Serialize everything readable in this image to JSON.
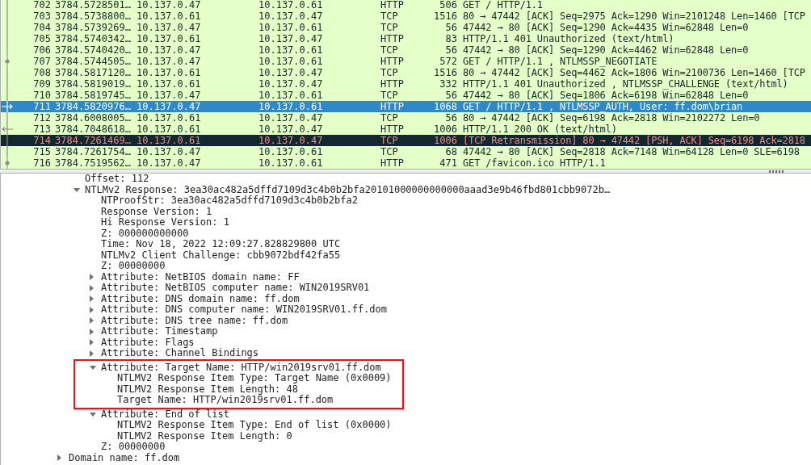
{
  "packet_list": {
    "rows": [
      {
        "no": "702",
        "time": "3784.5728501…",
        "source": "10.137.0.47",
        "destination": "10.137.0.61",
        "protocol": "HTTP",
        "length": "506",
        "info": "GET / HTTP/1.1",
        "kind": "normal",
        "endpoint": false,
        "request": false,
        "response": false,
        "selected": false
      },
      {
        "no": "703",
        "time": "3784.5738800…",
        "source": "10.137.0.61",
        "destination": "10.137.0.47",
        "protocol": "TCP",
        "length": "1516",
        "info": "80 → 47442 [ACK] Seq=2975 Ack=1290 Win=2101248 Len=1460 [TCP",
        "kind": "normal",
        "endpoint": false,
        "request": false,
        "response": false,
        "selected": false
      },
      {
        "no": "704",
        "time": "3784.5739269…",
        "source": "10.137.0.47",
        "destination": "10.137.0.61",
        "protocol": "TCP",
        "length": "56",
        "info": "47442 → 80 [ACK] Seq=1290 Ack=4435 Win=62848 Len=0",
        "kind": "normal",
        "endpoint": false,
        "request": false,
        "response": false,
        "selected": false
      },
      {
        "no": "705",
        "time": "3784.5740342…",
        "source": "10.137.0.61",
        "destination": "10.137.0.47",
        "protocol": "HTTP",
        "length": "83",
        "info": "HTTP/1.1 401 Unauthorized  (text/html)",
        "kind": "normal",
        "endpoint": false,
        "request": false,
        "response": false,
        "selected": false
      },
      {
        "no": "706",
        "time": "3784.5740420…",
        "source": "10.137.0.47",
        "destination": "10.137.0.61",
        "protocol": "TCP",
        "length": "56",
        "info": "47442 → 80 [ACK] Seq=1290 Ack=4462 Win=62848 Len=0",
        "kind": "normal",
        "endpoint": false,
        "request": false,
        "response": false,
        "selected": false
      },
      {
        "no": "707",
        "time": "3784.5744505…",
        "source": "10.137.0.47",
        "destination": "10.137.0.61",
        "protocol": "HTTP",
        "length": "572",
        "info": "GET / HTTP/1.1 , NTLMSSP_NEGOTIATE",
        "kind": "normal",
        "endpoint": true,
        "request": false,
        "response": false,
        "selected": false
      },
      {
        "no": "708",
        "time": "3784.5817120…",
        "source": "10.137.0.61",
        "destination": "10.137.0.47",
        "protocol": "TCP",
        "length": "1516",
        "info": "80 → 47442 [ACK] Seq=4462 Ack=1806 Win=2100736 Len=1460 [TCP",
        "kind": "normal",
        "endpoint": false,
        "request": false,
        "response": false,
        "selected": false
      },
      {
        "no": "709",
        "time": "3784.5819019…",
        "source": "10.137.0.61",
        "destination": "10.137.0.47",
        "protocol": "HTTP",
        "length": "332",
        "info": "HTTP/1.1 401 Unauthorized , NTLMSSP_CHALLENGE (text/html)",
        "kind": "normal",
        "endpoint": false,
        "request": false,
        "response": false,
        "selected": false
      },
      {
        "no": "710",
        "time": "3784.5819745…",
        "source": "10.137.0.47",
        "destination": "10.137.0.61",
        "protocol": "TCP",
        "length": "56",
        "info": "47442 → 80 [ACK] Seq=1806 Ack=6198 Win=62848 Len=0",
        "kind": "normal",
        "endpoint": false,
        "request": false,
        "response": false,
        "selected": false
      },
      {
        "no": "711",
        "time": "3784.5820976…",
        "source": "10.137.0.47",
        "destination": "10.137.0.61",
        "protocol": "HTTP",
        "length": "1068",
        "info": "GET / HTTP/1.1 , NTLMSSP_AUTH, User: ff.dom\\brian",
        "kind": "normal",
        "endpoint": false,
        "request": true,
        "response": false,
        "selected": true
      },
      {
        "no": "712",
        "time": "3784.6008005…",
        "source": "10.137.0.61",
        "destination": "10.137.0.47",
        "protocol": "TCP",
        "length": "56",
        "info": "80 → 47442 [ACK] Seq=6198 Ack=2818 Win=2102272 Len=0",
        "kind": "normal",
        "endpoint": false,
        "request": false,
        "response": false,
        "selected": false
      },
      {
        "no": "713",
        "time": "3784.7048618…",
        "source": "10.137.0.61",
        "destination": "10.137.0.47",
        "protocol": "HTTP",
        "length": "1006",
        "info": "HTTP/1.1 200 OK  (text/html)",
        "kind": "normal",
        "endpoint": false,
        "request": false,
        "response": true,
        "selected": false
      },
      {
        "no": "714",
        "time": "3784.7261469…",
        "source": "10.137.0.61",
        "destination": "10.137.0.47",
        "protocol": "TCP",
        "length": "1006",
        "info": "[TCP Retransmission] 80 → 47442 [PSH, ACK] Seq=6198 Ack=2818",
        "kind": "bad",
        "endpoint": false,
        "request": false,
        "response": false,
        "selected": false
      },
      {
        "no": "715",
        "time": "3784.7261754…",
        "source": "10.137.0.47",
        "destination": "10.137.0.61",
        "protocol": "TCP",
        "length": "68",
        "info": "47442 → 80 [ACK] Seq=2818 Ack=7148 Win=64128 Len=0 SLE=6198",
        "kind": "normal",
        "endpoint": false,
        "request": false,
        "response": false,
        "selected": false
      },
      {
        "no": "716",
        "time": "3784.7519562…",
        "source": "10.137.0.47",
        "destination": "10.137.0.61",
        "protocol": "HTTP",
        "length": "471",
        "info": "GET /favicon.ico HTTP/1.1",
        "kind": "normal",
        "endpoint": true,
        "request": false,
        "response": false,
        "selected": false
      }
    ]
  },
  "packet_details": {
    "items": [
      {
        "kind": "continuation",
        "children": [
          {
            "kind": "field",
            "label": "Offset: 112"
          },
          {
            "kind": "node",
            "label": "NTLMv2 Response: 3ea30ac482a5dffd7109d3c4b0b2bfa20101000000000000aaad3e9b46fbd801cbb9072b…",
            "expanded": true,
            "children": [
              {
                "kind": "field",
                "label": "NTProofStr: 3ea30ac482a5dffd7109d3c4b0b2bfa2"
              },
              {
                "kind": "field",
                "label": "Response Version: 1"
              },
              {
                "kind": "field",
                "label": "Hi Response Version: 1"
              },
              {
                "kind": "field",
                "label": "Z: 000000000000"
              },
              {
                "kind": "field",
                "label": "Time: Nov 18, 2022 12:09:27.828829800 UTC"
              },
              {
                "kind": "field",
                "label": "NTLMv2 Client Challenge: cbb9072bdf42fa55"
              },
              {
                "kind": "field",
                "label": "Z: 00000000"
              },
              {
                "kind": "node",
                "label": "Attribute: NetBIOS domain name: FF",
                "expanded": false
              },
              {
                "kind": "node",
                "label": "Attribute: NetBIOS computer name: WIN2019SRV01",
                "expanded": false
              },
              {
                "kind": "node",
                "label": "Attribute: DNS domain name: ff.dom",
                "expanded": false
              },
              {
                "kind": "node",
                "label": "Attribute: DNS computer name: WIN2019SRV01.ff.dom",
                "expanded": false
              },
              {
                "kind": "node",
                "label": "Attribute: DNS tree name: ff.dom",
                "expanded": false
              },
              {
                "kind": "node",
                "label": "Attribute: Timestamp",
                "expanded": false
              },
              {
                "kind": "node",
                "label": "Attribute: Flags",
                "expanded": false
              },
              {
                "kind": "node",
                "label": "Attribute: Channel Bindings",
                "expanded": false
              },
              {
                "kind": "node",
                "label": "Attribute: Target Name: HTTP/win2019srv01.ff.dom",
                "expanded": true,
                "highlighted": true,
                "children": [
                  {
                    "kind": "field",
                    "label": "NTLMV2 Response Item Type: Target Name (0x0009)"
                  },
                  {
                    "kind": "field",
                    "label": "NTLMV2 Response Item Length: 48"
                  },
                  {
                    "kind": "field",
                    "label": "Target Name: HTTP/win2019srv01.ff.dom"
                  }
                ]
              },
              {
                "kind": "node",
                "label": "Attribute: End of list",
                "expanded": true,
                "children": [
                  {
                    "kind": "field",
                    "label": "NTLMV2 Response Item Type: End of list (0x0000)"
                  },
                  {
                    "kind": "field",
                    "label": "NTLMV2 Response Item Length: 0"
                  }
                ]
              },
              {
                "kind": "field",
                "label": "Z: 00000000"
              }
            ]
          }
        ]
      },
      {
        "kind": "node",
        "label": "Domain name: ff.dom",
        "expanded": false
      }
    ]
  }
}
